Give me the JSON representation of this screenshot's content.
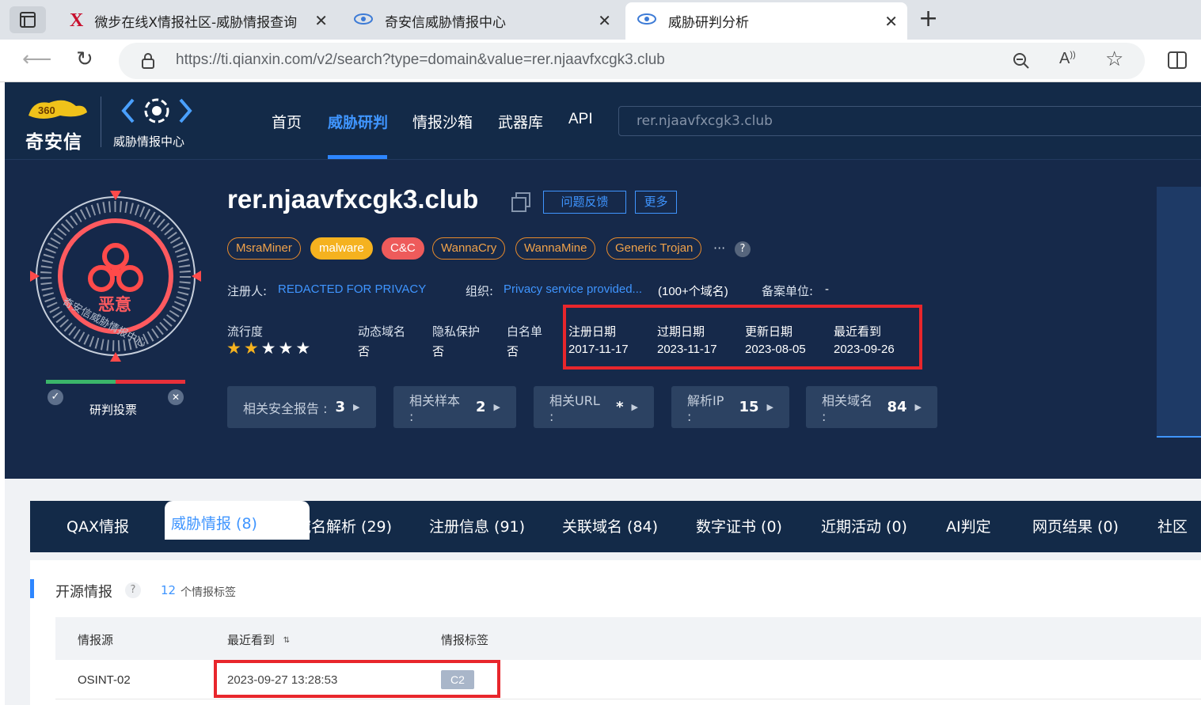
{
  "browser": {
    "tabs": [
      {
        "title": "微步在线X情报社区-威胁情报查询",
        "icon": "x-logo-icon"
      },
      {
        "title": "奇安信威胁情报中心",
        "icon": "qianxin-logo-icon"
      },
      {
        "title": "威胁研判分析",
        "icon": "qianxin-logo-icon",
        "active": true
      }
    ],
    "url": "https://ti.qianxin.com/v2/search?type=domain&value=rer.njaavfxcgk3.club"
  },
  "site": {
    "brand": "奇安信",
    "brand_sub": "威胁情报中心",
    "nav": [
      "首页",
      "威胁研判",
      "情报沙箱",
      "武器库",
      "API"
    ],
    "nav_active": 1,
    "search_value": "rer.njaavfxcgk3.club"
  },
  "hero": {
    "badge_verdict": "恶意",
    "badge_ring_text": "奇安信威胁情报中心",
    "vote_label": "研判投票",
    "domain": "rer.njaavfxcgk3.club",
    "feedback_btn": "问题反馈",
    "more_btn": "更多",
    "tags": [
      "MsraMiner",
      "malware",
      "C&C",
      "WannaCry",
      "WannaMine",
      "Generic Trojan"
    ],
    "tags_more": "···",
    "help": "?",
    "registrant_label": "注册人:",
    "registrant": "REDACTED FOR PRIVACY",
    "org_label": "组织:",
    "org": "Privacy service provided...",
    "org_count": "(100+个域名)",
    "icp_label": "备案单位:",
    "icp": "-",
    "popularity_label": "流行度",
    "popularity_stars": 2,
    "popularity_max": 5,
    "fields": [
      {
        "label": "动态域名",
        "value": "否"
      },
      {
        "label": "隐私保护",
        "value": "否"
      },
      {
        "label": "白名单",
        "value": "否"
      }
    ],
    "dates": [
      {
        "label": "注册日期",
        "value": "2017-11-17"
      },
      {
        "label": "过期日期",
        "value": "2023-11-17"
      },
      {
        "label": "更新日期",
        "value": "2023-08-05"
      },
      {
        "label": "最近看到",
        "value": "2023-09-26"
      }
    ],
    "stats": [
      {
        "label": "相关安全报告 :",
        "value": "3"
      },
      {
        "label": "相关样本 :",
        "value": "2"
      },
      {
        "label": "相关URL :",
        "value": "*"
      },
      {
        "label": "解析IP :",
        "value": "15"
      },
      {
        "label": "相关域名 :",
        "value": "84"
      }
    ]
  },
  "detail_tabs": [
    "QAX情报",
    "威胁情报 (8)",
    "域名解析 (29)",
    "注册信息 (91)",
    "关联域名 (84)",
    "数字证书 (0)",
    "近期活动 (0)",
    "AI判定",
    "网页结果 (0)",
    "社区"
  ],
  "detail_active": 1,
  "osint": {
    "title": "开源情报",
    "help": "?",
    "count": "12",
    "count_suffix": "个情报标签",
    "columns": [
      "情报源",
      "最近看到",
      "情报标签"
    ],
    "rows": [
      {
        "source": "OSINT-02",
        "last_seen": "2023-09-27 13:28:53",
        "tag": "C2"
      }
    ]
  }
}
